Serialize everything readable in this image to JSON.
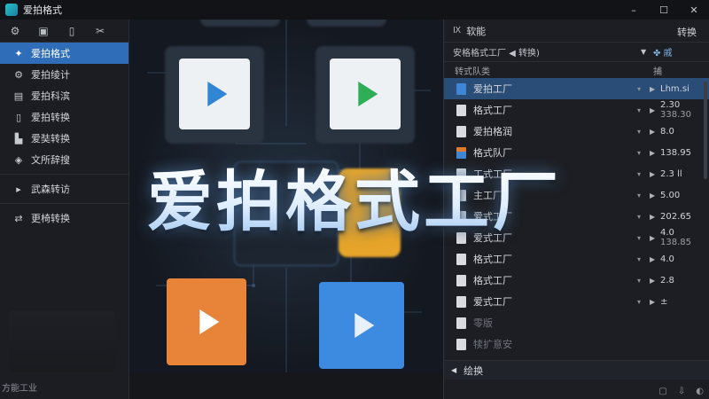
{
  "window": {
    "title": "爱拍格式",
    "controls": [
      "–",
      "☐",
      "✕"
    ]
  },
  "sidebar": {
    "items": [
      {
        "label": "爱拍格式",
        "icon": "bird-logo-icon",
        "active": true
      },
      {
        "label": "爱拍绫计",
        "icon": "gear-icon"
      },
      {
        "label": "爱拍科滨",
        "icon": "doc-icon"
      },
      {
        "label": "爱拍转换",
        "icon": "file-icon"
      },
      {
        "label": "爱奘转换",
        "icon": "stamp-icon"
      },
      {
        "label": "文所辞搜",
        "icon": "shield-icon"
      }
    ],
    "group_label": "武森转访",
    "extra_item": "更椅转换",
    "footer": "方能工业"
  },
  "headline": "爱拍格式工厂",
  "right_panel": {
    "header_prefix": "Ⅸ",
    "header_title": "软能",
    "switch_label": "转换",
    "select_value": "安格格式工厂  ◀ 转换)",
    "select_right": "✤ 戚",
    "col_left": "转式队类",
    "col_right": "捕",
    "rows": [
      {
        "name": "爱拍工厂",
        "value": "Lhm.si",
        "sub": "",
        "selected": true,
        "icon": "blue"
      },
      {
        "name": "格式工厂",
        "value": "2.30",
        "sub": "338.30",
        "icon": "white"
      },
      {
        "name": "爱拍格润",
        "value": "8.0",
        "sub": "",
        "icon": "white"
      },
      {
        "name": "格式队厂",
        "value": "138.95",
        "sub": "",
        "icon": "chart"
      },
      {
        "name": "工式工厂",
        "value": "2.3 ll",
        "sub": "",
        "icon": "white"
      },
      {
        "name": "主工厂",
        "value": "5.00",
        "sub": "",
        "icon": "white"
      },
      {
        "name": "爱式工厂",
        "value": "202.65",
        "sub": "",
        "icon": "white"
      },
      {
        "name": "爱式工厂",
        "value": "4.0",
        "sub": "138.85",
        "icon": "white"
      },
      {
        "name": "格式工厂",
        "value": "4.0",
        "sub": "",
        "icon": "white"
      },
      {
        "name": "格式工厂",
        "value": "2.8",
        "sub": "",
        "icon": "white"
      },
      {
        "name": "爱式工厂",
        "value": "±",
        "sub": "",
        "icon": "white"
      },
      {
        "name": "零版",
        "value": "",
        "sub": "",
        "icon": "white",
        "ghost": true
      },
      {
        "name": "犊扩意安",
        "value": "",
        "sub": "",
        "icon": "white",
        "ghost": true
      }
    ],
    "bottom_label": "绘换"
  },
  "colors": {
    "accent": "#2f6db8",
    "selected_row": "#2a4d78",
    "background": "#15171b"
  }
}
